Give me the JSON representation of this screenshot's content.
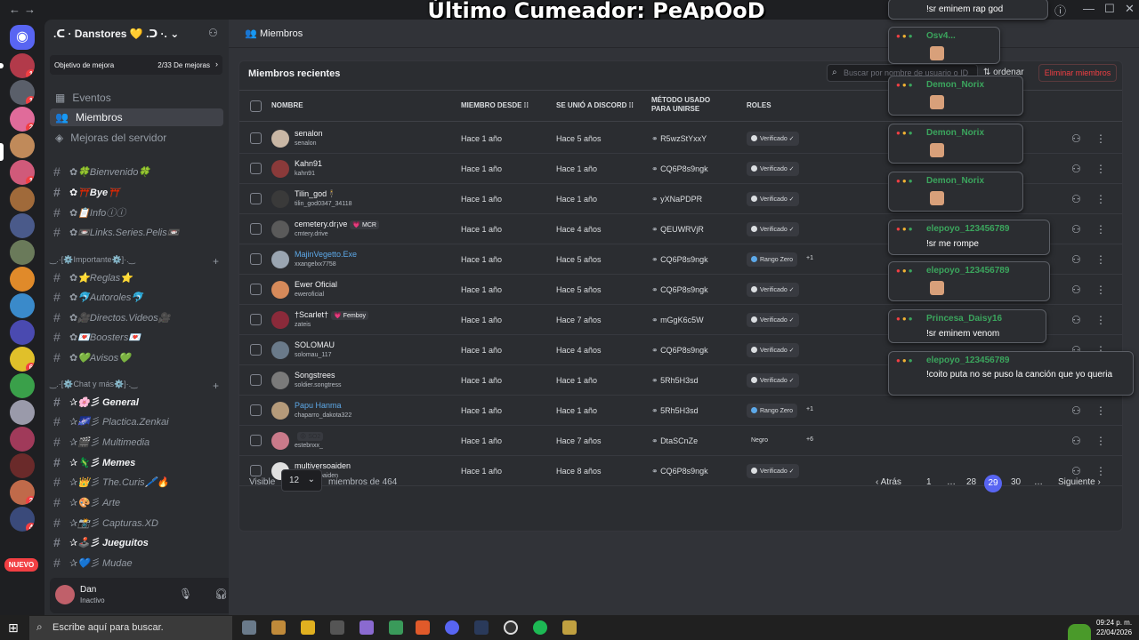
{
  "overlay": {
    "title": "Último Cumeador: PeApOoD"
  },
  "server": {
    "name": ".ᑕ · Danstores 💛 .ᑐ ·.",
    "boost_label": "Objetivo de mejora",
    "boost_count": "2/33 De mejoras"
  },
  "nav": {
    "events": "Eventos",
    "members": "Miembros",
    "boosts": "Mejoras del servidor"
  },
  "channels": [
    {
      "name": "✿🍀Bienvenido🍀",
      "bold": false
    },
    {
      "name": "✿⛩️Bye⛩️",
      "bold": true
    },
    {
      "name": "✿📋Infoⓘⓘ",
      "bold": false
    },
    {
      "name": "✿📼Links.Series.Pelis📼",
      "bold": false
    }
  ],
  "cat1": "‿.·[⚙️Importante⚙️]·.‿",
  "channels2": [
    {
      "name": "✿⭐Reglas⭐",
      "bold": false
    },
    {
      "name": "✿🐬Autoroles🐬",
      "bold": false
    },
    {
      "name": "✿🎥Directos.Videos🎥",
      "bold": false
    },
    {
      "name": "✿💌Boosters💌",
      "bold": false
    },
    {
      "name": "✿💚Avisos💚",
      "bold": false
    }
  ],
  "cat2": "‿.·[⚙️Chat y más⚙️]·.‿",
  "channels3": [
    {
      "name": "✰🌸彡 General",
      "bold": true
    },
    {
      "name": "✰🌌彡 Plactica.Zenkai",
      "bold": false
    },
    {
      "name": "✰🎬彡 Multimedia",
      "bold": false
    },
    {
      "name": "✰🦎彡 Memes",
      "bold": true
    },
    {
      "name": "✰👑彡 The.Curis🖊️🔥",
      "bold": false
    },
    {
      "name": "✰🎨彡 Arte",
      "bold": false
    },
    {
      "name": "✰📸彡 Capturas.XD",
      "bold": false
    },
    {
      "name": "✰🕹️彡 Jueguitos",
      "bold": true
    },
    {
      "name": "✰💙彡 Mudae",
      "bold": false
    }
  ],
  "nuevo": "NUEVO",
  "user": {
    "name": "Dan",
    "status": "Inactivo"
  },
  "header": {
    "title": "Miembros"
  },
  "panel": {
    "title": "Miembros recientes",
    "search_placeholder": "Buscar por nombre de usuario o ID",
    "sort": "ordenar",
    "delete": "Eliminar miembros"
  },
  "columns": {
    "name": "NOMBRE",
    "since": "MIEMBRO DESDE",
    "joined": "SE UNIÓ A DISCORD",
    "method": "MÉTODO USADO PARA UNIRSE",
    "roles": "ROLES"
  },
  "rows": [
    {
      "name": "senalon",
      "user": "senalon",
      "since": "Hace 1 año",
      "joined": "Hace 5 años",
      "invite": "R5wzStYxxY",
      "role": "Verificado ✓",
      "extra": "",
      "color": "#f2f3f5",
      "avatar": "#c9b7a5"
    },
    {
      "name": "Kahn91",
      "user": "kahn91",
      "since": "Hace 1 año",
      "joined": "Hace 1 año",
      "invite": "CQ6P8s9ngk",
      "role": "Verificado ✓",
      "extra": "",
      "color": "#f2f3f5",
      "avatar": "#8a3a3a"
    },
    {
      "name": "Tilin_god🕴",
      "user": "tilin_god0347_34118",
      "since": "Hace 1 año",
      "joined": "Hace 1 año",
      "invite": "yXNaPDPR",
      "role": "Verificado ✓",
      "extra": "",
      "color": "#f2f3f5",
      "avatar": "#3a3a3a"
    },
    {
      "name": "cemetery.dr¡ve",
      "user": "cmtery.drive",
      "since": "Hace 1 año",
      "joined": "Hace 4 años",
      "invite": "QEUWRVjR",
      "role": "Verificado ✓",
      "extra": "",
      "tag": "💗 MCR",
      "color": "#f2f3f5",
      "avatar": "#5a5a5a"
    },
    {
      "name": "MajinVegetto.Exe",
      "user": "xxangelxx7758",
      "since": "Hace 1 año",
      "joined": "Hace 5 años",
      "invite": "CQ6P8s9ngk",
      "role": "Rango Zero",
      "extra": "+1",
      "color": "#5da9e9",
      "avatar": "#9aa5b1"
    },
    {
      "name": "Ewer Oficial",
      "user": "eweroficial",
      "since": "Hace 1 año",
      "joined": "Hace 5 años",
      "invite": "CQ6P8s9ngk",
      "role": "Verificado ✓",
      "extra": "",
      "color": "#f2f3f5",
      "avatar": "#d68a5a"
    },
    {
      "name": "†Scarlet†",
      "user": "zateis",
      "since": "Hace 1 año",
      "joined": "Hace 7 años",
      "invite": "mGgK6c5W",
      "role": "Verificado ✓",
      "extra": "",
      "tag": "💗 Femboy",
      "color": "#f2f3f5",
      "avatar": "#8a2a3a"
    },
    {
      "name": "SOLOMAU",
      "user": "solomau_117",
      "since": "Hace 1 año",
      "joined": "Hace 4 años",
      "invite": "CQ6P8s9ngk",
      "role": "Verificado ✓",
      "extra": "",
      "color": "#f2f3f5",
      "avatar": "#6a7a8a"
    },
    {
      "name": "Songstrees",
      "user": "soldier.songtress",
      "since": "Hace 1 año",
      "joined": "Hace 1 año",
      "invite": "5Rh5H3sd",
      "role": "Verificado ✓",
      "extra": "",
      "color": "#f2f3f5",
      "avatar": "#7a7a7a"
    },
    {
      "name": "Papu Hanma",
      "user": "chaparro_dakota322",
      "since": "Hace 1 año",
      "joined": "Hace 1 año",
      "invite": "5Rh5H3sd",
      "role": "Rango Zero",
      "extra": "+1",
      "color": "#5da9e9",
      "avatar": "#b59a7a"
    },
    {
      "name": "",
      "user": "estebnxx_",
      "since": "Hace 1 año",
      "joined": "Hace 7 años",
      "invite": "DtaSCnZe",
      "role": "Negro",
      "extra": "+6",
      "tag": "😡 SO2",
      "color": "#2b2d31",
      "avatar": "#c97a8a"
    },
    {
      "name": "multiversoaiden",
      "user": "multiversoaiden",
      "since": "Hace 1 año",
      "joined": "Hace 8 años",
      "invite": "CQ6P8s9ngk",
      "role": "Verificado ✓",
      "extra": "",
      "color": "#f2f3f5",
      "avatar": "#e0e0e0"
    }
  ],
  "footer": {
    "visible": "Visible",
    "per_page": "12",
    "members_of": "miembros de 464",
    "prev": "Atrás",
    "p1": "1",
    "e1": "…",
    "p28": "28",
    "p29": "29",
    "p30": "30",
    "e2": "…",
    "next": "Siguiente"
  },
  "chat": [
    {
      "user": "",
      "msg": "!sr eminem rap god"
    },
    {
      "user": "Osv4...",
      "msg": ""
    },
    {
      "user": "Demon_Norix",
      "msg": ""
    },
    {
      "user": "Demon_Norix",
      "msg": ""
    },
    {
      "user": "Demon_Norix",
      "msg": ""
    },
    {
      "user": "elepoyo_123456789",
      "msg": "!sr me rompe"
    },
    {
      "user": "elepoyo_123456789",
      "msg": ""
    },
    {
      "user": "Princesa_Daisy16",
      "msg": "!sr eminem venom"
    },
    {
      "user": "elepoyo_123456789",
      "msg": "!coito puta no se puso la canción que yo queria"
    }
  ],
  "taskbar": {
    "search": "Escribe aquí para buscar.",
    "time": "09:24 p. m.",
    "date": "22/04/2026"
  }
}
